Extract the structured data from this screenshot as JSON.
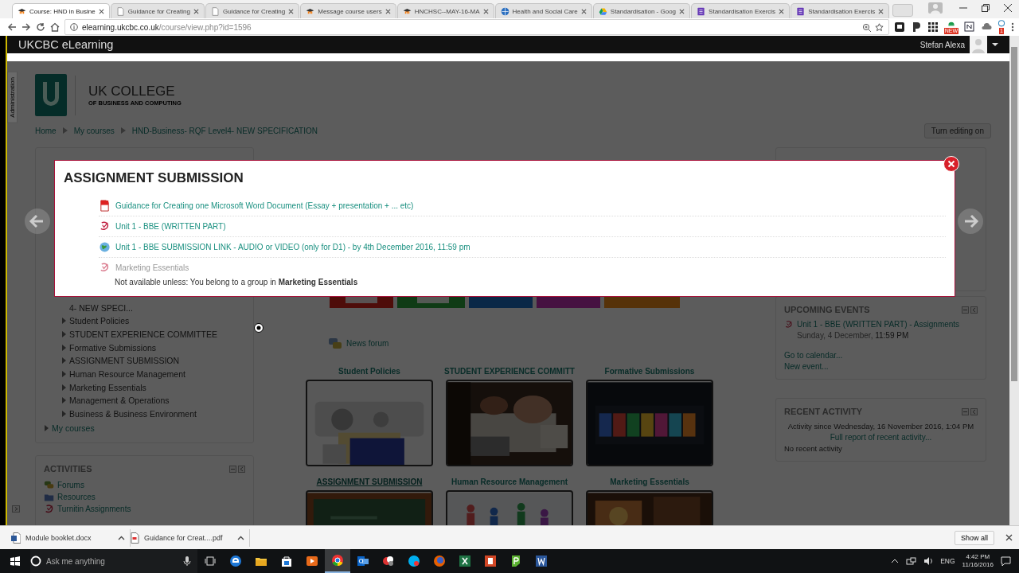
{
  "browser": {
    "tabs": [
      {
        "title": "Course: HND in Busine",
        "kind": "moodle",
        "selected": true
      },
      {
        "title": "Guidance for Creating",
        "kind": "page",
        "selected": false
      },
      {
        "title": "Guidance for Creating",
        "kind": "page",
        "selected": false
      },
      {
        "title": "Message course users",
        "kind": "moodle",
        "selected": false
      },
      {
        "title": "HNCHSC--MAY-16-MA",
        "kind": "moodle",
        "selected": false
      },
      {
        "title": "Health and Social Care",
        "kind": "health",
        "selected": false
      },
      {
        "title": "Standardisation - Goog",
        "kind": "drive",
        "selected": false
      },
      {
        "title": "Standardisation Exercis",
        "kind": "form",
        "selected": false
      },
      {
        "title": "Standardisation Exercis",
        "kind": "form",
        "selected": false
      }
    ],
    "address": {
      "host": "elearning.ukcbc.co.uk",
      "path": "/course/view.php?id=1596"
    },
    "badges": [
      "NEW",
      "1"
    ]
  },
  "site": {
    "name": "UKCBC eLearning",
    "user": "Stefan Alexa"
  },
  "admin_tab": "Administration",
  "header": {
    "college": "UK COLLEGE",
    "tagline": "OF BUSINESS AND COMPUTING"
  },
  "breadcrumb": [
    "Home",
    "My courses",
    "HND-Business- RQF Level4- NEW SPECIFICATION"
  ],
  "edit_button": "Turn editing on",
  "navigation": {
    "course": "4- NEW SPECI...",
    "sections": [
      "Student Policies",
      "STUDENT EXPERIENCE COMMITTEE",
      "Formative Submissions",
      "ASSIGNMENT SUBMISSION",
      "Human Resource Management",
      "Marketing Essentials",
      "Management & Operations",
      "Business & Business Environment"
    ],
    "my_courses": "My courses"
  },
  "activities": {
    "title": "ACTIVITIES",
    "items": [
      {
        "label": "Forums",
        "kind": "forum"
      },
      {
        "label": "Resources",
        "kind": "resource"
      },
      {
        "label": "Turnitin Assignments",
        "kind": "turnitin"
      }
    ]
  },
  "news_forum": "News forum",
  "tiles": [
    {
      "title": "Student Policies",
      "hovered": false
    },
    {
      "title": "STUDENT EXPERIENCE COMMITT",
      "hovered": false
    },
    {
      "title": "Formative Submissions",
      "hovered": false
    },
    {
      "title": "ASSIGNMENT SUBMISSION",
      "hovered": true
    },
    {
      "title": "Human Resource Management",
      "hovered": false
    },
    {
      "title": "Marketing Essentials",
      "hovered": false
    }
  ],
  "upcoming": {
    "title": "UPCOMING EVENTS",
    "events": [
      {
        "name": "Unit 1 - BBE (WRITTEN PART) - Assignments",
        "date": "Sunday, 4 December,",
        "time": "11:59 PM"
      }
    ],
    "links": [
      "Go to calendar...",
      "New event..."
    ]
  },
  "recent": {
    "title": "RECENT ACTIVITY",
    "since": "Activity since Wednesday, 16 November 2016, 1:04 PM",
    "report": "Full report of recent activity...",
    "empty": "No recent activity"
  },
  "modal": {
    "title": "ASSIGNMENT SUBMISSION",
    "items": [
      {
        "label": "Guidance for Creating one Microsoft Word Document (Essay + presentation + ... etc)",
        "kind": "pdf",
        "disabled": false
      },
      {
        "label": "Unit 1 - BBE (WRITTEN PART)",
        "kind": "turnitin",
        "disabled": false
      },
      {
        "label": "Unit 1 - BBE SUBMISSION LINK - AUDIO or VIDEO (only for D1) - by 4th December 2016, 11:59 pm",
        "kind": "url",
        "disabled": false
      },
      {
        "label": "Marketing Essentials",
        "kind": "turnitin",
        "disabled": true,
        "restriction": "Not available unless: You belong to a group in **Marketing Essentials**"
      }
    ]
  },
  "downloads": {
    "files": [
      {
        "name": "Module booklet.docx",
        "kind": "docx"
      },
      {
        "name": "Guidance for Creat....pdf",
        "kind": "pdf"
      }
    ],
    "show_all": "Show all"
  },
  "taskbar": {
    "search_placeholder": "Ask me anything",
    "apps": [
      {
        "kind": "edge",
        "selected": false
      },
      {
        "kind": "explorer",
        "selected": false
      },
      {
        "kind": "store",
        "selected": false
      },
      {
        "kind": "media",
        "selected": false
      },
      {
        "kind": "chrome",
        "selected": true
      },
      {
        "kind": "outlook",
        "selected": false
      },
      {
        "kind": "paint",
        "selected": false
      },
      {
        "kind": "skype",
        "selected": false
      },
      {
        "kind": "firefox",
        "selected": false
      },
      {
        "kind": "excel",
        "selected": false
      },
      {
        "kind": "powerpoint",
        "selected": false
      },
      {
        "kind": "green",
        "selected": false
      },
      {
        "kind": "word",
        "selected": false
      }
    ],
    "language": "ENG",
    "time": "4:42 PM",
    "date": "11/16/2016"
  }
}
